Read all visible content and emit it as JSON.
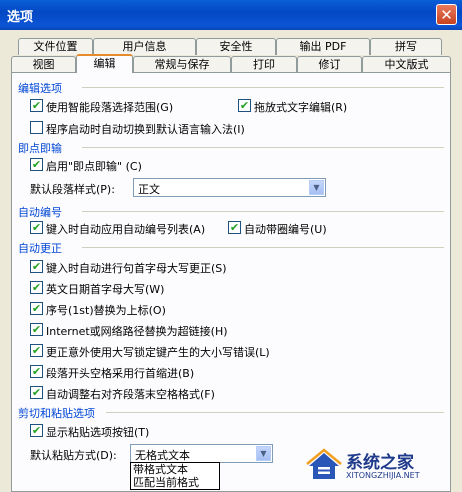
{
  "window": {
    "title": "选项",
    "close": "✕"
  },
  "tabs_back": [
    "文件位置",
    "用户信息",
    "安全性",
    "输出 PDF",
    "拼写"
  ],
  "tabs_front": [
    "视图",
    "编辑",
    "常规与保存",
    "打印",
    "修订",
    "中文版式"
  ],
  "active_tab": "编辑",
  "sections": {
    "edit": "编辑选项",
    "click": "即点即输",
    "autonum": "自动编号",
    "autocorrect": "自动更正",
    "paste": "剪切和粘贴选项"
  },
  "options": {
    "smart_para": {
      "label": "使用智能段落选择范围(G)",
      "checked": true
    },
    "drag_edit": {
      "label": "拖放式文字编辑(R)",
      "checked": true
    },
    "auto_ime": {
      "label": "程序启动时自动切换到默认语言输入法(I)",
      "checked": false
    },
    "click_type": {
      "label": "启用\"即点即输\" (C)",
      "checked": true
    },
    "auto_list": {
      "label": "键入时自动应用自动编号列表(A)",
      "checked": true
    },
    "circle_num": {
      "label": "自动带圈编号(U)",
      "checked": true
    },
    "capitalize_first": {
      "label": "键入时自动进行句首字母大写更正(S)",
      "checked": true
    },
    "english_date": {
      "label": "英文日期首字母大写(W)",
      "checked": true
    },
    "ordinal": {
      "label": "序号(1st)替换为上标(O)",
      "checked": true
    },
    "hyperlink": {
      "label": "Internet或网络路径替换为超链接(H)",
      "checked": true
    },
    "capslock": {
      "label": "更正意外使用大写锁定键产生的大小写错误(L)",
      "checked": true
    },
    "indent_space": {
      "label": "段落开头空格采用行首缩进(B)",
      "checked": true
    },
    "align_space": {
      "label": "自动调整右对齐段落末空格格式(F)",
      "checked": true
    },
    "paste_btn": {
      "label": "显示粘贴选项按钮(T)",
      "checked": true
    }
  },
  "default_para_style": {
    "label": "默认段落样式(P):",
    "value": "正文"
  },
  "default_paste": {
    "label": "默认粘贴方式(D):",
    "value": "无格式文本",
    "options": [
      "带格式文本",
      "匹配当前格式"
    ]
  },
  "watermark": {
    "name": "系统之家",
    "url": "XITONGZHIJIA.NET"
  },
  "icons": {
    "check": "✔",
    "arrow": "▼"
  },
  "colors": {
    "title_bar": "#0a5fd8",
    "section": "#0046d5",
    "check": "#21a121"
  }
}
